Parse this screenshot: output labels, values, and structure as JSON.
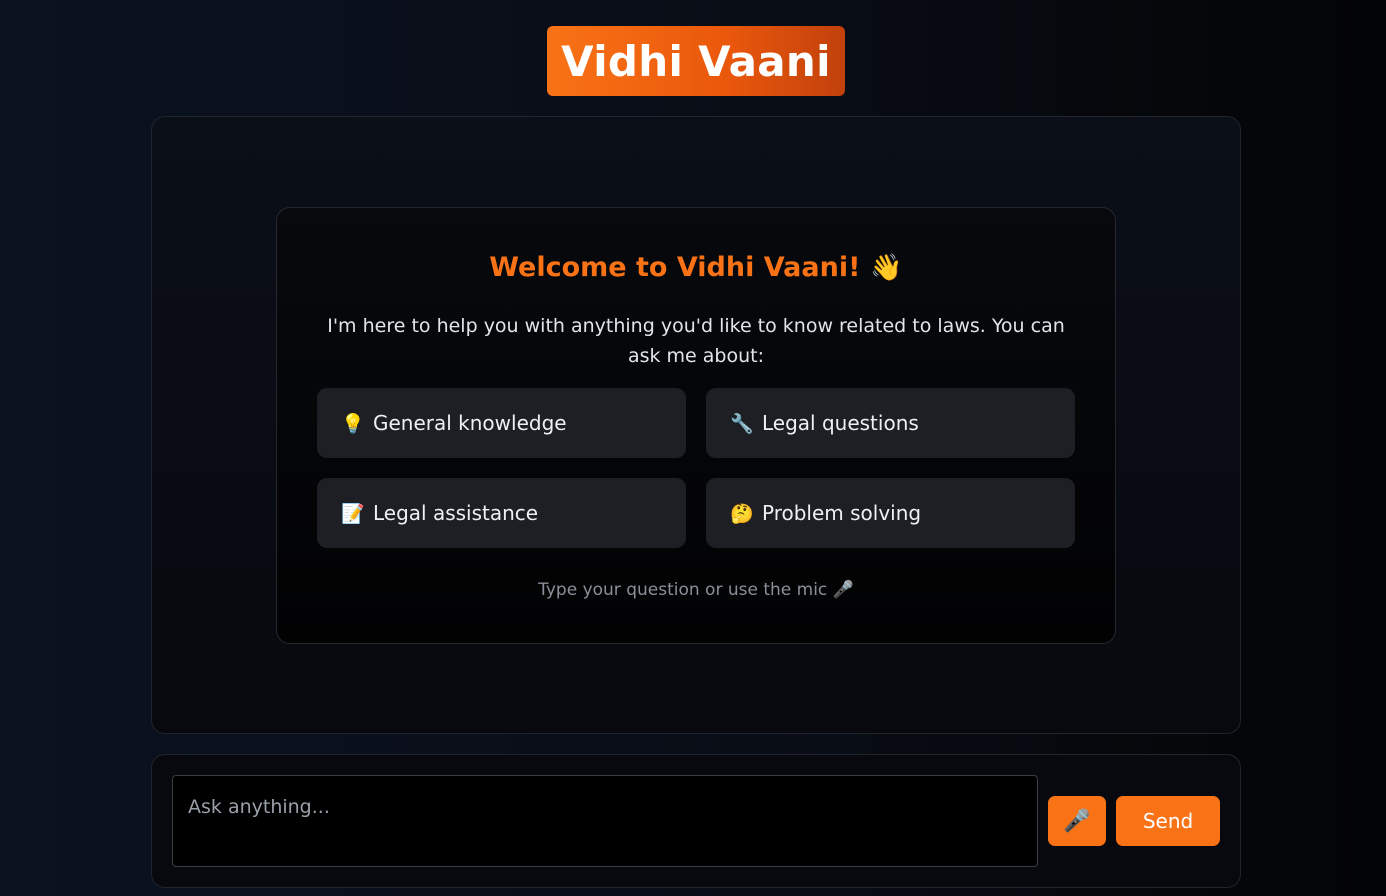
{
  "header": {
    "title": "Vidhi Vaani"
  },
  "welcome": {
    "title": "Welcome to Vidhi Vaani!",
    "title_icon": "👋",
    "intro": "I'm here to help you with anything you'd like to know related to laws. You can ask me about:",
    "topics": [
      {
        "icon": "💡",
        "icon_name": "lightbulb-icon",
        "label": "General knowledge"
      },
      {
        "icon": "🔧",
        "icon_name": "wrench-icon",
        "label": "Legal questions"
      },
      {
        "icon": "📝",
        "icon_name": "memo-icon",
        "label": "Legal assistance"
      },
      {
        "icon": "🤔",
        "icon_name": "thinking-face-icon",
        "label": "Problem solving"
      }
    ],
    "hint": "Type your question or use the mic 🎤"
  },
  "composer": {
    "placeholder": "Ask anything...",
    "mic_icon": "🎤",
    "send_label": "Send"
  },
  "colors": {
    "accent": "#f97316",
    "background": "#0b1220",
    "card": "#1d1f24"
  }
}
